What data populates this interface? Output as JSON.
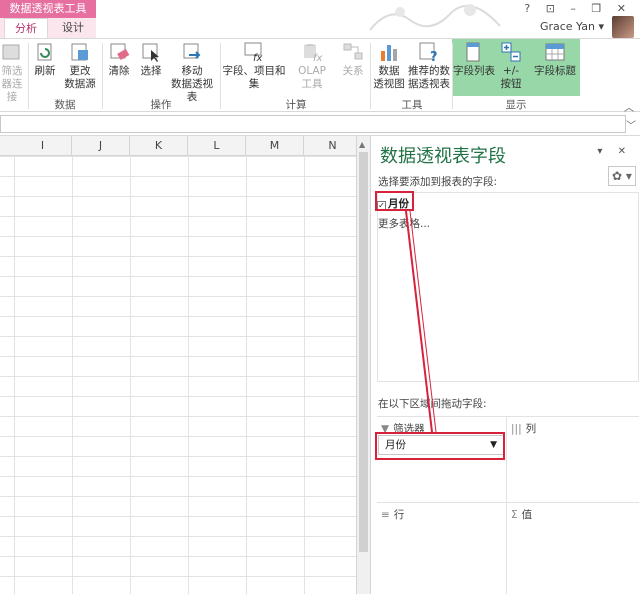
{
  "titlebar": {
    "context_tab": "数据透视表工具",
    "tabs": [
      "分析",
      "设计"
    ],
    "window_controls": "? ⊡ – ❐ ✕",
    "user_name": "Grace Yan ▾"
  },
  "ribbon": {
    "buttons": {
      "filter_connections": "筛选\n器连接",
      "refresh": "刷新",
      "change_source": "更改\n数据源",
      "clear": "清除",
      "select": "选择",
      "move_pivot": "移动\n数据透视表",
      "fields_items": "字段、项目和\n集",
      "olap": "OLAP\n工具",
      "relations": "关系",
      "pivot_chart": "数据\n透视图",
      "recommended": "推荐的数\n据透视表",
      "field_list": "字段列表",
      "plus_minus": "+/-\n按钮",
      "field_headers": "字段标题"
    },
    "groups": [
      "数据",
      "操作",
      "计算",
      "工具",
      "显示"
    ]
  },
  "grid": {
    "columns": [
      "I",
      "J",
      "K",
      "L",
      "M",
      "N"
    ]
  },
  "pane": {
    "title": "数据透视表字段",
    "controls": "▾ ✕",
    "choose_label": "选择要添加到报表的字段:",
    "gear": "✿ ▾",
    "fields": [
      {
        "label": "月份",
        "checked": true
      }
    ],
    "more_tables": "更多表格...",
    "drag_label": "在以下区域间拖动字段:",
    "areas": {
      "filters": {
        "icon": "▼",
        "label": "筛选器"
      },
      "columns": {
        "icon": "|||",
        "label": "列"
      },
      "rows": {
        "icon": "≡",
        "label": "行"
      },
      "values": {
        "icon": "Σ",
        "label": "值"
      }
    },
    "filter_item": "月份"
  },
  "colors": {
    "context_tab": "#e66fa0",
    "accent_green": "#217346",
    "show_group_highlight": "#98d8a8",
    "annotation_red": "#d6223a"
  }
}
